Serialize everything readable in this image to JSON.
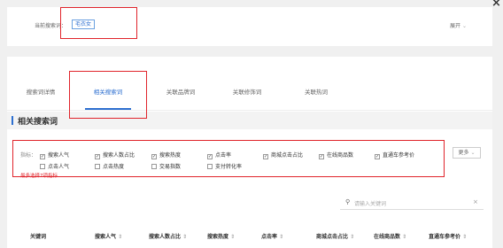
{
  "close_icon": "×",
  "top": {
    "current_label": "当前搜索词：",
    "current_keyword": "毛衣女",
    "expand_label": "展开",
    "expand_icon": "chevron-down-icon"
  },
  "tabs": [
    {
      "label": "搜索词详情",
      "active": false
    },
    {
      "label": "相关搜索词",
      "active": true
    },
    {
      "label": "关联品牌词",
      "active": false
    },
    {
      "label": "关联修饰词",
      "active": false
    },
    {
      "label": "关联热词",
      "active": false
    }
  ],
  "section_title": "相关搜索词",
  "metrics": {
    "label": "指标：",
    "row1": [
      {
        "label": "搜索人气",
        "checked": true
      },
      {
        "label": "搜索人数占比",
        "checked": true
      },
      {
        "label": "搜索热度",
        "checked": true
      },
      {
        "label": "点击率",
        "checked": true
      },
      {
        "label": "商城点击占比",
        "checked": true
      },
      {
        "label": "在线商品数",
        "checked": true
      },
      {
        "label": "直通车参考价",
        "checked": true
      }
    ],
    "row2": [
      {
        "label": "点击人气",
        "checked": false
      },
      {
        "label": "点击热度",
        "checked": false
      },
      {
        "label": "交易指数",
        "checked": false
      },
      {
        "label": "支付转化率",
        "checked": false
      }
    ],
    "hint": "最多选择7项指标",
    "more_label": "更多"
  },
  "search": {
    "placeholder": "请输入关键词",
    "clear": "×"
  },
  "table": {
    "columns": [
      {
        "label": "关键词",
        "sortable": false
      },
      {
        "label": "搜索人气",
        "sortable": true
      },
      {
        "label": "搜索人数占比",
        "sortable": true
      },
      {
        "label": "搜索热度",
        "sortable": true
      },
      {
        "label": "点击率",
        "sortable": true
      },
      {
        "label": "商城点击占比",
        "sortable": true
      },
      {
        "label": "在线商品数",
        "sortable": true
      },
      {
        "label": "直通车参考价",
        "sortable": true
      }
    ],
    "sort_icon": "⇕"
  },
  "colors": {
    "accent": "#2d6fd0",
    "highlight": "#e0242b"
  }
}
